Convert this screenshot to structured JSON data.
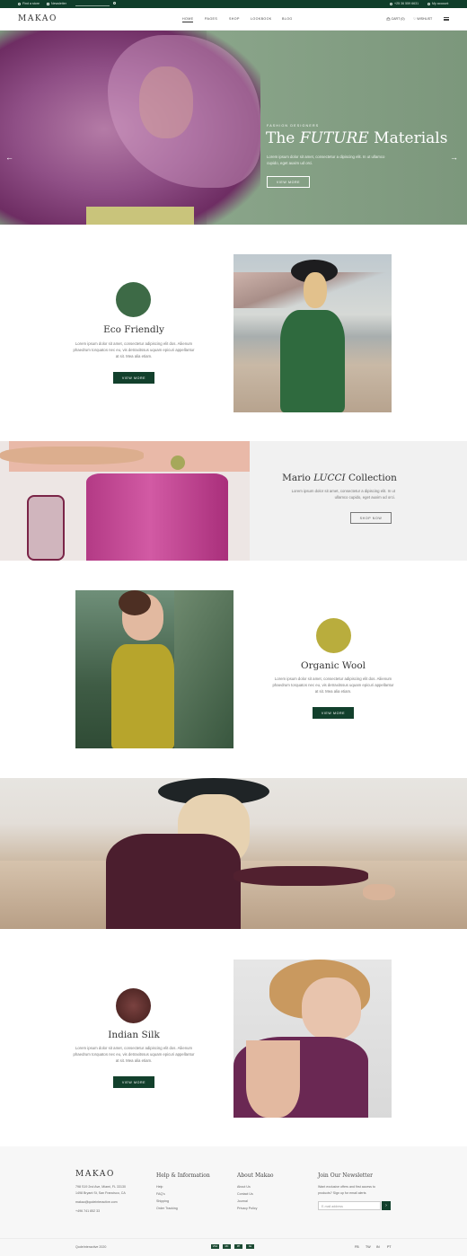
{
  "topbar": {
    "find_store": "Find a store",
    "newsletter": "Newsletter",
    "phone": "+25 36 559 6631",
    "account": "My account"
  },
  "header": {
    "logo": "MAKAO",
    "nav": [
      "HOME",
      "PAGES",
      "SHOP",
      "LOOKBOOK",
      "BLOG"
    ],
    "active_nav": "HOME",
    "cart": "CART (0)",
    "wishlist": "WISHLIST"
  },
  "hero": {
    "eyebrow": "FASHION DESIGNERS",
    "title_pre": "The",
    "title_em": "FUTURE",
    "title_post": "Materials",
    "desc": "Lorem ipsum dolor sit amet, consectetur a dipiscing elit. In ut ullamco cupido, eget auxim ud orci.",
    "button": "VIEW MORE"
  },
  "eco": {
    "title": "Eco Friendly",
    "desc": "Lorem ipsum dolor sit amet, consectetur adipiscing elit dos. Aliienum phaedrum torquatos nec eu, vis detraxitssus uquam epicuri appellantur at sit. Mea alia etiam.",
    "button": "VIEW MORE",
    "swatch_color": "#3d6a46"
  },
  "mario": {
    "title_pre": "Mario",
    "title_em": "LUCCI",
    "title_post": "Collection",
    "desc": "Lorem ipsum dolor sit amet, consectetur a dipiscing elit. In ut ullamco cupido, eget auxim ud orci.",
    "button": "SHOP NOW"
  },
  "wool": {
    "title": "Organic Wool",
    "desc": "Lorem ipsum dolor sit amet, consectetur adipiscing elit dos. Aliienum phaedrum torquatos nec eu, vis detraxitssus uquam epicuri appellantur at sit. Mea alia etiam.",
    "button": "VIEW MORE",
    "swatch_color": "#b9ad3d"
  },
  "silk": {
    "title": "Indian Silk",
    "desc": "Lorem ipsum dolor sit amet, consectetur adipiscing elit dos. Aliienum phaedrum torquatos nec eu, vis detraxitssus uquam epicuri appellantur at sit. Mea alia etiam.",
    "button": "VIEW MORE",
    "swatch_color": "#5a2d2a"
  },
  "footer": {
    "logo": "MAKAO",
    "address1": "798 S19 2nd Ave, Miami, FL 33130",
    "address2": "1498 Bryant St, San Francisco, CA",
    "email": "makao@qodeinteractive.com",
    "phone": "+496 741 852 33",
    "help_title": "Help & Information",
    "help_links": [
      "Help",
      "FAQ's",
      "Shipping",
      "Order Tracking"
    ],
    "about_title": "About Makao",
    "about_links": [
      "About Us",
      "Contact Us",
      "Journal",
      "Privacy Policy"
    ],
    "newsletter_title": "Join Our Newsletter",
    "newsletter_text1": "Want exclusive offers and first access to",
    "newsletter_text2": "products? Sign up for email alerts",
    "email_placeholder": "E-mail address",
    "copyright": "QodeInteractive 2020",
    "payments": [
      "VISA",
      "MC",
      "PP",
      "AE"
    ],
    "social": [
      "FB",
      "TW",
      "IN",
      "PT"
    ]
  },
  "colors": {
    "brand_green": "#12402c",
    "topbar": "#0f3d2a"
  }
}
